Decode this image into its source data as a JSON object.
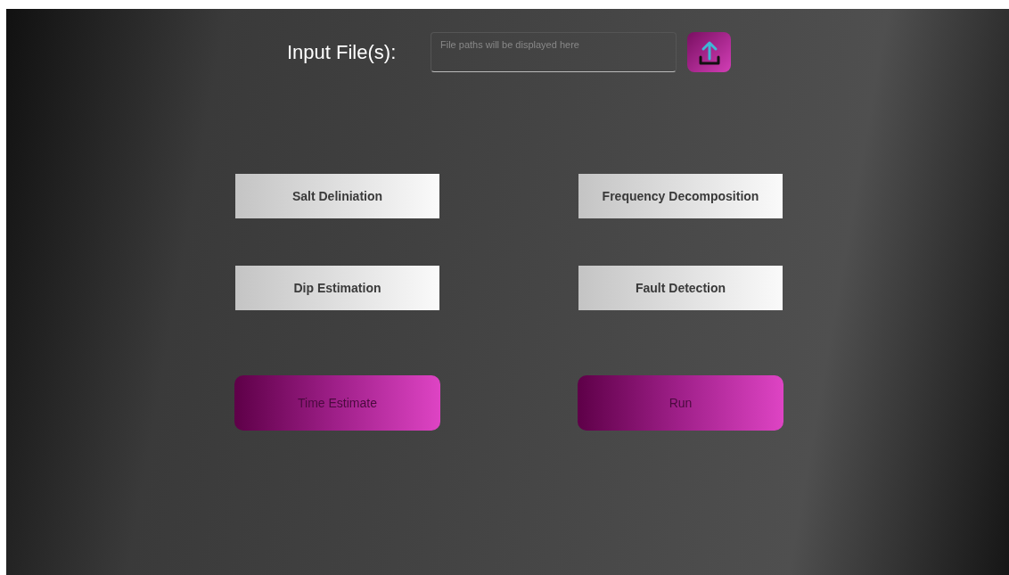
{
  "input_row": {
    "label": "Input File(s):",
    "placeholder": "File paths will be displayed here"
  },
  "options": [
    {
      "label": "Salt Deliniation"
    },
    {
      "label": "Frequency Decomposition"
    },
    {
      "label": "Dip Estimation"
    },
    {
      "label": "Fault Detection"
    }
  ],
  "actions": [
    {
      "label": "Time Estimate"
    },
    {
      "label": "Run"
    }
  ]
}
